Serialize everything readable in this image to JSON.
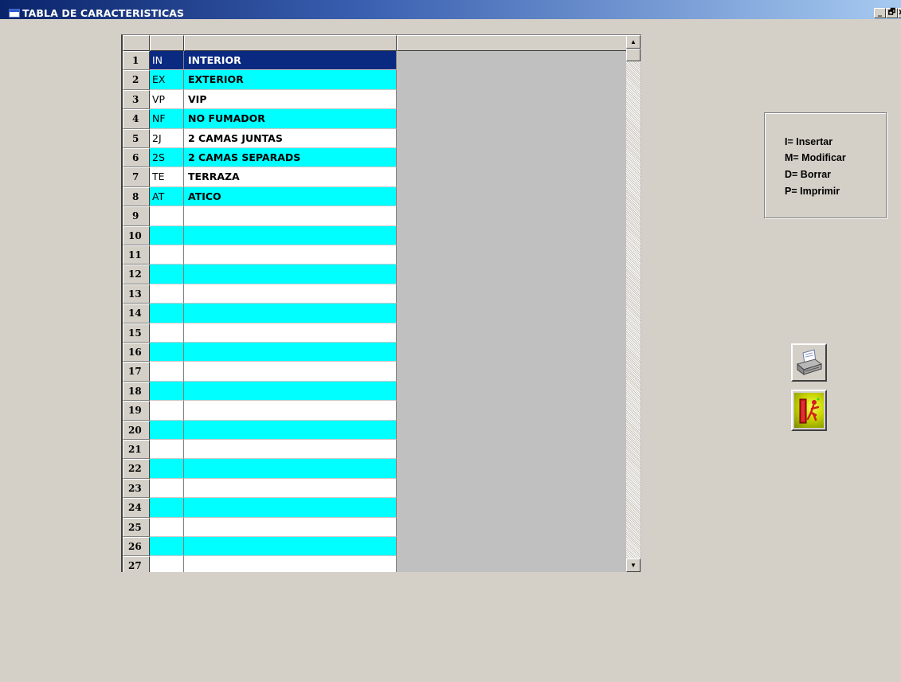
{
  "window": {
    "title": "TABLA DE CARACTERISTICAS",
    "controls": {
      "minimize": "_",
      "restore": "🗗",
      "close": "x"
    }
  },
  "grid": {
    "rows": [
      {
        "num": "1",
        "code": "IN",
        "desc": "INTERIOR",
        "state": "selected"
      },
      {
        "num": "2",
        "code": "EX",
        "desc": "EXTERIOR",
        "state": "cyan"
      },
      {
        "num": "3",
        "code": "VP",
        "desc": "VIP",
        "state": "white"
      },
      {
        "num": "4",
        "code": "NF",
        "desc": "NO FUMADOR",
        "state": "cyan"
      },
      {
        "num": "5",
        "code": "2J",
        "desc": "2 CAMAS JUNTAS",
        "state": "white"
      },
      {
        "num": "6",
        "code": "2S",
        "desc": "2 CAMAS SEPARADS",
        "state": "cyan"
      },
      {
        "num": "7",
        "code": "TE",
        "desc": "TERRAZA",
        "state": "white"
      },
      {
        "num": "8",
        "code": "AT",
        "desc": "ATICO",
        "state": "cyan"
      },
      {
        "num": "9",
        "code": "",
        "desc": "",
        "state": "white"
      },
      {
        "num": "10",
        "code": "",
        "desc": "",
        "state": "cyan"
      },
      {
        "num": "11",
        "code": "",
        "desc": "",
        "state": "white"
      },
      {
        "num": "12",
        "code": "",
        "desc": "",
        "state": "cyan"
      },
      {
        "num": "13",
        "code": "",
        "desc": "",
        "state": "white"
      },
      {
        "num": "14",
        "code": "",
        "desc": "",
        "state": "cyan"
      },
      {
        "num": "15",
        "code": "",
        "desc": "",
        "state": "white"
      },
      {
        "num": "16",
        "code": "",
        "desc": "",
        "state": "cyan"
      },
      {
        "num": "17",
        "code": "",
        "desc": "",
        "state": "white"
      },
      {
        "num": "18",
        "code": "",
        "desc": "",
        "state": "cyan"
      },
      {
        "num": "19",
        "code": "",
        "desc": "",
        "state": "white"
      },
      {
        "num": "20",
        "code": "",
        "desc": "",
        "state": "cyan"
      },
      {
        "num": "21",
        "code": "",
        "desc": "",
        "state": "white"
      },
      {
        "num": "22",
        "code": "",
        "desc": "",
        "state": "cyan"
      },
      {
        "num": "23",
        "code": "",
        "desc": "",
        "state": "white"
      },
      {
        "num": "24",
        "code": "",
        "desc": "",
        "state": "cyan"
      },
      {
        "num": "25",
        "code": "",
        "desc": "",
        "state": "white"
      },
      {
        "num": "26",
        "code": "",
        "desc": "",
        "state": "cyan"
      },
      {
        "num": "27",
        "code": "",
        "desc": "",
        "state": "white"
      }
    ]
  },
  "legend": {
    "lines": [
      "I= Insertar",
      "M= Modificar",
      "D= Borrar",
      "P= Imprimir"
    ]
  },
  "buttons": {
    "print_icon": "printer-icon",
    "exit_icon": "exit-door-icon"
  },
  "colors": {
    "row_alt": "#00ffff",
    "row_selected": "#0a2a82",
    "grid_bg": "#c0c0c0"
  }
}
